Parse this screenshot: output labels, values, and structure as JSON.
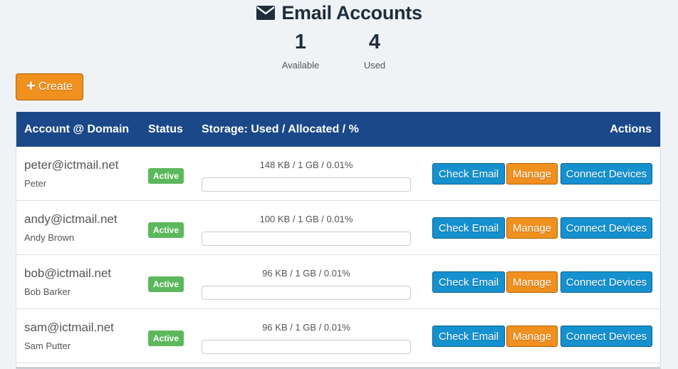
{
  "header": {
    "title": "Email Accounts",
    "icon": "envelope-icon"
  },
  "stats": {
    "available": {
      "value": "1",
      "label": "Available"
    },
    "used": {
      "value": "4",
      "label": "Used"
    }
  },
  "toolbar": {
    "create_label": "Create",
    "create_icon": "plus-icon"
  },
  "table": {
    "columns": {
      "account": "Account @ Domain",
      "status": "Status",
      "storage": "Storage: Used / Allocated / %",
      "actions": "Actions"
    },
    "rows": [
      {
        "email": "peter@ictmail.net",
        "name": "Peter",
        "status": "Active",
        "storage": "148 KB / 1 GB / 0.01%",
        "percent": 0.01,
        "check": "Check Email",
        "manage": "Manage",
        "connect": "Connect Devices"
      },
      {
        "email": "andy@ictmail.net",
        "name": "Andy Brown",
        "status": "Active",
        "storage": "100 KB / 1 GB / 0.01%",
        "percent": 0.01,
        "check": "Check Email",
        "manage": "Manage",
        "connect": "Connect Devices"
      },
      {
        "email": "bob@ictmail.net",
        "name": "Bob Barker",
        "status": "Active",
        "storage": "96 KB / 1 GB / 0.01%",
        "percent": 0.01,
        "check": "Check Email",
        "manage": "Manage",
        "connect": "Connect Devices"
      },
      {
        "email": "sam@ictmail.net",
        "name": "Sam Putter",
        "status": "Active",
        "storage": "96 KB / 1 GB / 0.01%",
        "percent": 0.01,
        "check": "Check Email",
        "manage": "Manage",
        "connect": "Connect Devices"
      }
    ]
  },
  "colors": {
    "header_blue": "#1b4888",
    "button_blue": "#1591cf",
    "button_orange": "#f0901e",
    "status_green": "#5cb85c"
  }
}
